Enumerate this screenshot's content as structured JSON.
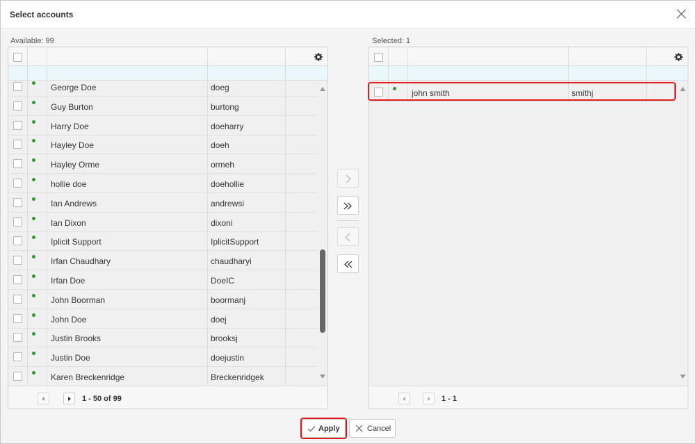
{
  "dialog": {
    "title": "Select accounts"
  },
  "available": {
    "count_label": "Available: 99",
    "rows": [
      {
        "name": "George Doe",
        "login": "doeg"
      },
      {
        "name": "Guy Burton",
        "login": "burtong"
      },
      {
        "name": "Harry Doe",
        "login": "doeharry"
      },
      {
        "name": "Hayley Doe",
        "login": "doeh"
      },
      {
        "name": "Hayley Orme",
        "login": "ormeh"
      },
      {
        "name": "hollie doe",
        "login": "doehollie"
      },
      {
        "name": "Ian Andrews",
        "login": "andrewsi"
      },
      {
        "name": "Ian Dixon",
        "login": "dixoni"
      },
      {
        "name": "Iplicit Support",
        "login": "IplicitSupport"
      },
      {
        "name": "Irfan Chaudhary",
        "login": "chaudharyi"
      },
      {
        "name": "Irfan Doe",
        "login": "DoeIC"
      },
      {
        "name": "John Boorman",
        "login": "boormanj"
      },
      {
        "name": "John Doe",
        "login": "doej"
      },
      {
        "name": "Justin Brooks",
        "login": "brooksj"
      },
      {
        "name": "Justin Doe",
        "login": "doejustin"
      },
      {
        "name": "Karen Breckenridge",
        "login": "Breckenridgek"
      }
    ],
    "pager_info": "1 - 50 of 99",
    "scroll_position": 0.8
  },
  "selected": {
    "count_label": "Selected: 1",
    "rows": [
      {
        "name": "john smith",
        "login": "smithj"
      }
    ],
    "pager_info": "1 - 1"
  },
  "footer": {
    "apply_label": "Apply",
    "cancel_label": "Cancel"
  },
  "icons": {
    "close": "close-icon",
    "gear": "gear-icon",
    "move_right": "chevron-right-icon",
    "move_all_right": "double-chevron-right-icon",
    "move_left": "chevron-left-icon",
    "move_all_left": "double-chevron-left-icon",
    "apply": "check-icon",
    "cancel": "x-icon"
  },
  "colors": {
    "status_active": "#2e9b2e",
    "highlight": "#e01a1a",
    "filter_row": "#eaf7fb"
  }
}
